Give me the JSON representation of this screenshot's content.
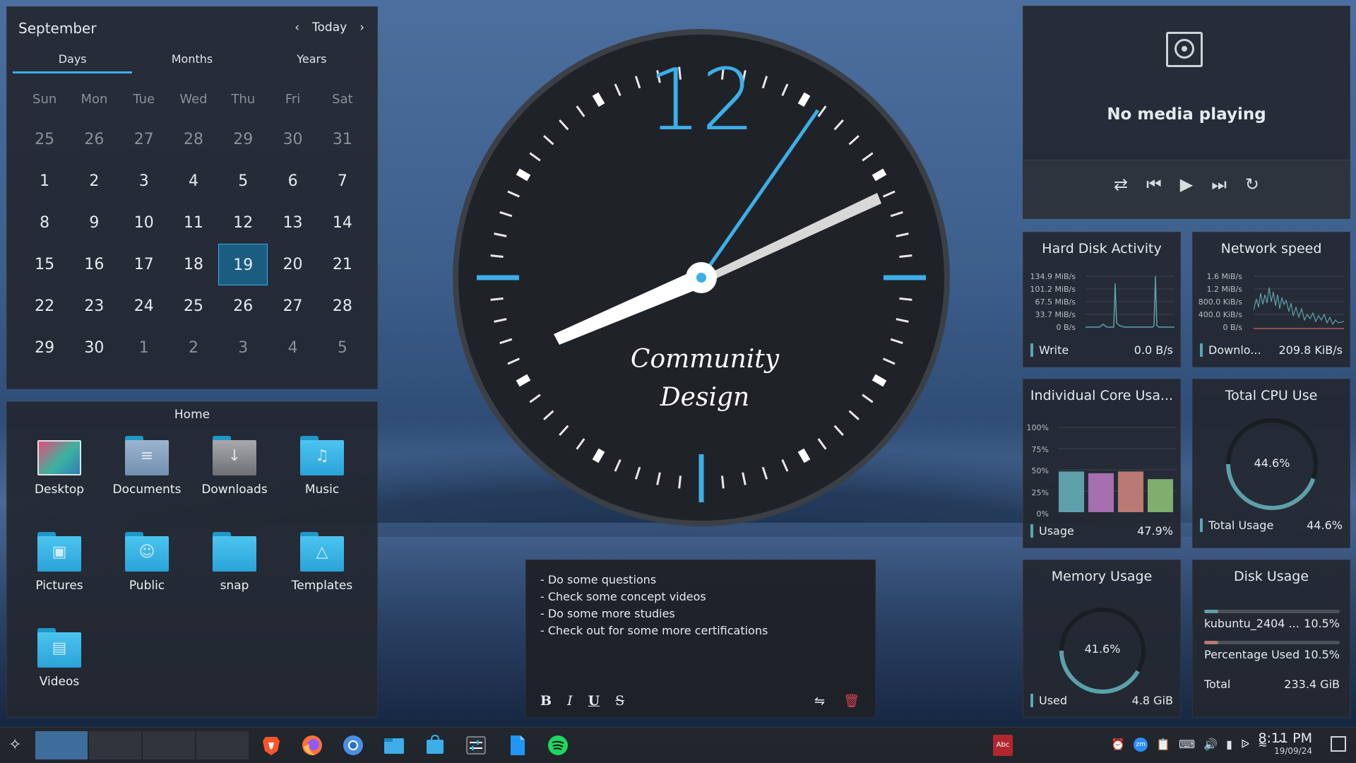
{
  "calendar": {
    "month": "September",
    "today_label": "Today",
    "tabs": [
      "Days",
      "Months",
      "Years"
    ],
    "weekdays": [
      "Sun",
      "Mon",
      "Tue",
      "Wed",
      "Thu",
      "Fri",
      "Sat"
    ],
    "days": [
      "25",
      "26",
      "27",
      "28",
      "29",
      "30",
      "31",
      "1",
      "2",
      "3",
      "4",
      "5",
      "6",
      "7",
      "8",
      "9",
      "10",
      "11",
      "12",
      "13",
      "14",
      "15",
      "16",
      "17",
      "18",
      "19",
      "20",
      "21",
      "22",
      "23",
      "24",
      "25",
      "26",
      "27",
      "28",
      "29",
      "30",
      "1",
      "2",
      "3",
      "4",
      "5"
    ],
    "today": "19"
  },
  "folder": {
    "title": "Home",
    "items": [
      {
        "label": "Desktop",
        "icon": "desktop-folder-icon"
      },
      {
        "label": "Documents",
        "icon": "documents-folder-icon"
      },
      {
        "label": "Downloads",
        "icon": "downloads-folder-icon"
      },
      {
        "label": "Music",
        "icon": "music-folder-icon"
      },
      {
        "label": "Pictures",
        "icon": "pictures-folder-icon"
      },
      {
        "label": "Public",
        "icon": "public-folder-icon"
      },
      {
        "label": "snap",
        "icon": "folder-icon"
      },
      {
        "label": "Templates",
        "icon": "templates-folder-icon"
      },
      {
        "label": "Videos",
        "icon": "videos-folder-icon"
      }
    ]
  },
  "clock": {
    "numeral": "12",
    "brand_line1": "Community",
    "brand_line2": "Design",
    "accent": "#3daee9"
  },
  "notes": {
    "lines": [
      "- Do some questions",
      "- Check some concept videos",
      "- Do some more studies",
      "- Check out for some more certifications"
    ],
    "format_buttons": [
      "B",
      "I",
      "U",
      "S"
    ]
  },
  "media": {
    "status": "No media playing"
  },
  "disk_activity": {
    "title": "Hard Disk Activity",
    "axis": [
      "134.9 MiB/s",
      "101.2 MiB/s",
      "67.5 MiB/s",
      "33.7 MiB/s",
      "0 B/s"
    ],
    "label": "Write",
    "value": "0.0 B/s"
  },
  "network": {
    "title": "Network speed",
    "axis": [
      "1.6 MiB/s",
      "1.2 MiB/s",
      "800.0 KiB/s",
      "400.0 KiB/s",
      "0 B/s"
    ],
    "label": "Downlo...",
    "value": "209.8 KiB/s"
  },
  "cores": {
    "title": "Individual Core Usa...",
    "axis": [
      "100%",
      "75%",
      "50%",
      "25%",
      "0%"
    ],
    "bars": [
      0.48,
      0.46,
      0.48,
      0.39
    ],
    "bar_colors": [
      "#5da0aa",
      "#a56fb0",
      "#b87a72",
      "#7fae6e"
    ],
    "label": "Usage",
    "value": "47.9%"
  },
  "cpu": {
    "title": "Total CPU Use",
    "percent": 44.6,
    "center": "44.6%",
    "label": "Total Usage",
    "value": "44.6%"
  },
  "memory": {
    "title": "Memory Usage",
    "percent": 41.6,
    "center": "41.6%",
    "label": "Used",
    "value": "4.8 GiB"
  },
  "disk_usage": {
    "title": "Disk Usage",
    "rows": [
      {
        "label": "kubuntu_2404 ...",
        "value": "10.5%",
        "fraction": 0.105,
        "color": "#5da0aa"
      },
      {
        "label": "Percentage Used",
        "value": "10.5%",
        "fraction": 0.105,
        "color": "#b87a72"
      }
    ],
    "total_label": "Total",
    "total_value": "233.4 GiB"
  },
  "taskbar": {
    "apps": [
      "brave-icon",
      "firefox-icon",
      "chromium-icon",
      "file-manager-icon",
      "store-icon",
      "settings-icon",
      "document-icon",
      "spotify-icon"
    ],
    "time": "8:11 PM",
    "date": "19/09/24"
  }
}
